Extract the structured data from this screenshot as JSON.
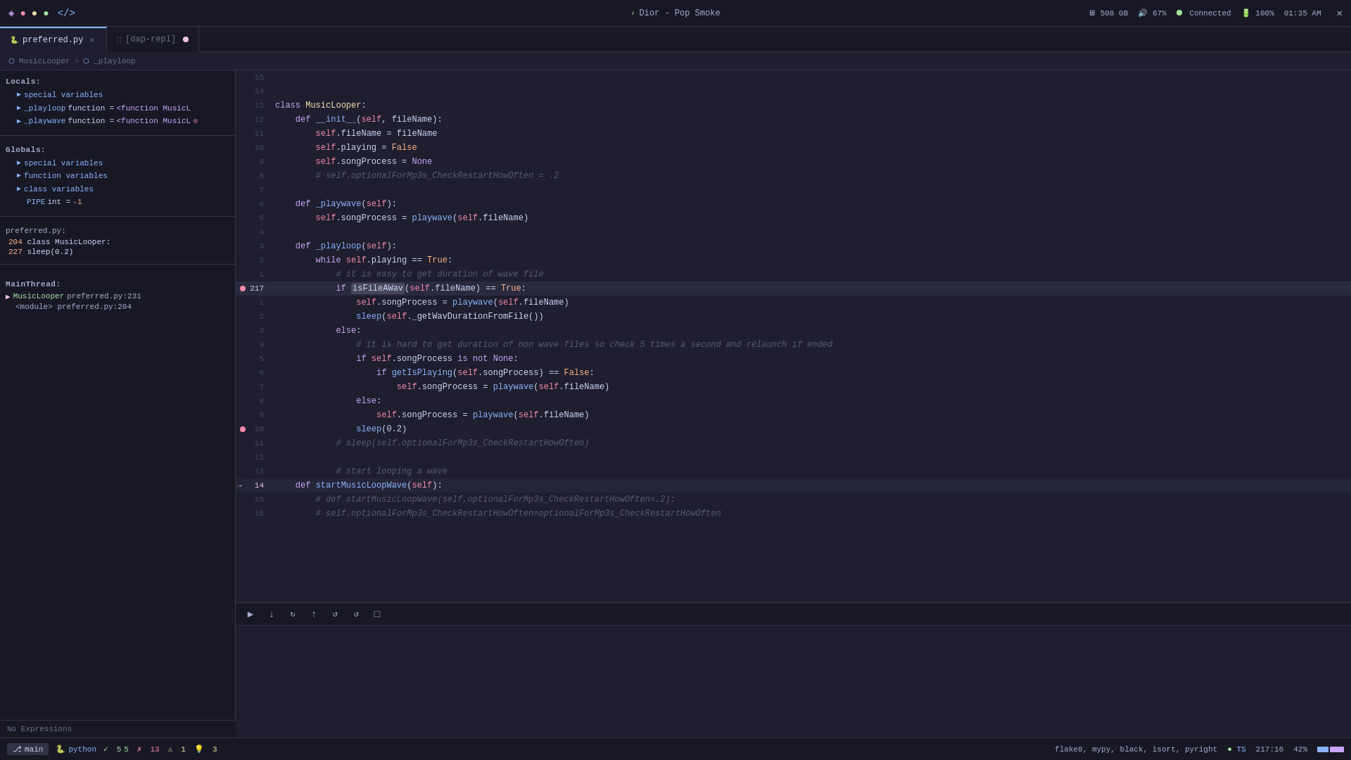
{
  "titlebar": {
    "left_icons": [
      "◈",
      "●",
      "○",
      "</>"
    ],
    "song": "Dior - Pop Smoke",
    "storage": "508 GB",
    "volume": "67%",
    "wifi": "Connected",
    "battery": "100%",
    "time": "01:35 AM"
  },
  "tabs": [
    {
      "id": "preferred",
      "label": "preferred.py",
      "active": true,
      "closable": true,
      "icon": "py"
    },
    {
      "id": "dap-repl",
      "label": "[dap-repl]",
      "active": false,
      "closable": false,
      "icon": "term"
    }
  ],
  "breadcrumb": {
    "items": [
      "MusicLooper",
      "_playloop"
    ]
  },
  "locals": {
    "title": "Locals:",
    "items": [
      {
        "arrow": true,
        "name": "special variables"
      },
      {
        "arrow": true,
        "name": "_playloop",
        "equals": "function = ",
        "value": "<function MusicL"
      },
      {
        "arrow": true,
        "name": "_playwave",
        "equals": "function = ",
        "value": "<function MusicL",
        "has_dot": true
      }
    ]
  },
  "globals": {
    "title": "Globals:",
    "items": [
      {
        "arrow": true,
        "name": "special variables"
      },
      {
        "arrow": true,
        "name": "function variables"
      },
      {
        "arrow": true,
        "name": "class variables"
      },
      {
        "name": "PIPE",
        "equals": "int = ",
        "value": "-1"
      }
    ]
  },
  "call_stack": {
    "title": "MainThread:",
    "items": [
      {
        "active": true,
        "name": "MusicLooper",
        "file": "preferred.py:231"
      },
      {
        "name": "<module>",
        "file": "preferred.py:204"
      }
    ]
  },
  "preferred_section": {
    "title": "preferred.py:",
    "lines": [
      {
        "num": "204",
        "text": "class MusicLooper:"
      },
      {
        "num": "227",
        "text": "sleep(0.2)"
      }
    ]
  },
  "expressions": "No Expressions",
  "code": {
    "lines": [
      {
        "num": "15",
        "content": "",
        "type": "empty"
      },
      {
        "num": "14",
        "content": "",
        "type": "empty"
      },
      {
        "num": "13",
        "content": "class MusicLooper:",
        "type": "code"
      },
      {
        "num": "12",
        "content": "    def __init__(self, fileName):",
        "type": "code"
      },
      {
        "num": "11",
        "content": "        self.fileName = fileName",
        "type": "code"
      },
      {
        "num": "10",
        "content": "        self.playing = False",
        "type": "code"
      },
      {
        "num": "9",
        "content": "        self.songProcess = None",
        "type": "code"
      },
      {
        "num": "8",
        "content": "        # self.optionalForMp3s_CheckRestartHowOften = .2",
        "type": "comment"
      },
      {
        "num": "7",
        "content": "",
        "type": "empty"
      },
      {
        "num": "6",
        "content": "    def _playwave(self):",
        "type": "code"
      },
      {
        "num": "5",
        "content": "        self.songProcess = playwave(self.fileName)",
        "type": "code"
      },
      {
        "num": "4",
        "content": "",
        "type": "empty"
      },
      {
        "num": "3",
        "content": "    def _playloop(self):",
        "type": "code"
      },
      {
        "num": "2",
        "content": "        while self.playing == True:",
        "type": "code"
      },
      {
        "num": "1",
        "content": "            # it is easy to get duration of wave file",
        "type": "comment"
      },
      {
        "num": "217",
        "content": "            if isFileAWav(self.fileName) == True:",
        "type": "code",
        "current": true,
        "has_bp": true
      },
      {
        "num": "1",
        "content": "                self.songProcess = playwave(self.fileName)",
        "type": "code"
      },
      {
        "num": "2",
        "content": "                sleep(self._getWavDurationFromFile())",
        "type": "code"
      },
      {
        "num": "3",
        "content": "            else:",
        "type": "code"
      },
      {
        "num": "4",
        "content": "                # it is hard to get duration of non wave files so check 5 times a second and relaunch if ended",
        "type": "comment"
      },
      {
        "num": "5",
        "content": "                if self.songProcess is not None:",
        "type": "code"
      },
      {
        "num": "6",
        "content": "                    if getIsPlaying(self.songProcess) == False:",
        "type": "code"
      },
      {
        "num": "7",
        "content": "                        self.songProcess = playwave(self.fileName)",
        "type": "code"
      },
      {
        "num": "8",
        "content": "                else:",
        "type": "code"
      },
      {
        "num": "9",
        "content": "                    self.songProcess = playwave(self.fileName)",
        "type": "code"
      },
      {
        "num": "10",
        "content": "                sleep(0.2)",
        "type": "code",
        "has_bp2": true
      },
      {
        "num": "11",
        "content": "            # sleep(self.optionalForMp3s_CheckRestartHowOften)",
        "type": "comment"
      },
      {
        "num": "12",
        "content": "",
        "type": "empty"
      },
      {
        "num": "13",
        "content": "            # start looping a wave",
        "type": "comment"
      },
      {
        "num": "14",
        "content": "    def startMusicLoopWave(self):",
        "type": "code",
        "has_arrow": true
      },
      {
        "num": "15",
        "content": "        # def startMusicLoopWave(self,optionalForMp3s_CheckRestartHowOften=.2):",
        "type": "comment"
      },
      {
        "num": "16",
        "content": "        # self.optionalForMp3s_CheckRestartHowOften=optionalForMp3s_CheckRestartHowOften",
        "type": "comment"
      }
    ]
  },
  "debug_controls": {
    "buttons": [
      "▶",
      "↓",
      "↻",
      "↑",
      "↺",
      "↺",
      "□"
    ]
  },
  "status_bar": {
    "branch": "main",
    "language": "python",
    "errors": {
      "green_count": "5",
      "green_label": "5",
      "red_count": "13",
      "yellow_count": "1",
      "warning_count": "3"
    },
    "linters": "flake8,  mypy,  black,  isort,  pyright",
    "ts": "TS",
    "position": "217:16",
    "zoom": "42%"
  }
}
